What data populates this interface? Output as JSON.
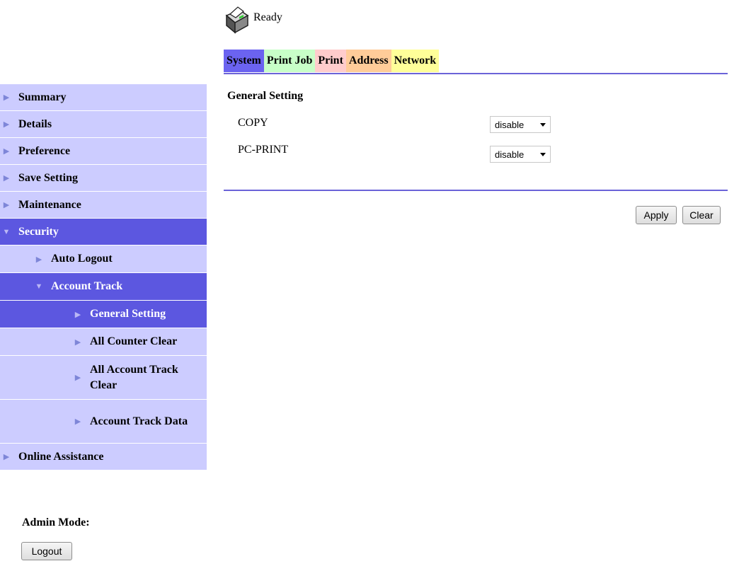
{
  "status": {
    "icon": "printer-icon",
    "text": "Ready"
  },
  "tabs": [
    {
      "label": "System",
      "color": "#6b63f0",
      "text_color": "#000000"
    },
    {
      "label": "Print Job",
      "color": "#c8ffc8",
      "text_color": "#000000"
    },
    {
      "label": "Print",
      "color": "#ffcccc",
      "text_color": "#000000"
    },
    {
      "label": "Address",
      "color": "#ffcc99",
      "text_color": "#000000"
    },
    {
      "label": "Network",
      "color": "#ffff99",
      "text_color": "#000000"
    }
  ],
  "sidebar": {
    "items": [
      {
        "label": "Summary",
        "level": 0,
        "selected": false,
        "expanded": false
      },
      {
        "label": "Details",
        "level": 0,
        "selected": false,
        "expanded": false
      },
      {
        "label": "Preference",
        "level": 0,
        "selected": false,
        "expanded": false
      },
      {
        "label": "Save Setting",
        "level": 0,
        "selected": false,
        "expanded": false
      },
      {
        "label": "Maintenance",
        "level": 0,
        "selected": false,
        "expanded": false
      },
      {
        "label": "Security",
        "level": 0,
        "selected": true,
        "expanded": true
      },
      {
        "label": "Auto Logout",
        "level": 1,
        "selected": false,
        "expanded": false
      },
      {
        "label": "Account Track",
        "level": 1,
        "selected": true,
        "expanded": true
      },
      {
        "label": "General Setting",
        "level": 2,
        "selected": true,
        "expanded": false
      },
      {
        "label": "All Counter Clear",
        "level": 2,
        "selected": false,
        "expanded": false
      },
      {
        "label": "All Account Track Clear",
        "level": 2,
        "selected": false,
        "expanded": false
      },
      {
        "label": "Account Track Data",
        "level": 2,
        "selected": false,
        "expanded": false
      },
      {
        "label": "Online Assistance",
        "level": 0,
        "selected": false,
        "expanded": false
      }
    ],
    "admin_mode_label": "Admin Mode:",
    "logout_label": "Logout"
  },
  "main": {
    "section_title": "General Setting",
    "settings": [
      {
        "label": "COPY",
        "value": "disable"
      },
      {
        "label": "PC-PRINT",
        "value": "disable"
      }
    ],
    "apply_label": "Apply",
    "clear_label": "Clear"
  },
  "colors": {
    "accent": "#5c57e0",
    "nav_bg": "#ccccff",
    "rule": "#6b63d8"
  }
}
